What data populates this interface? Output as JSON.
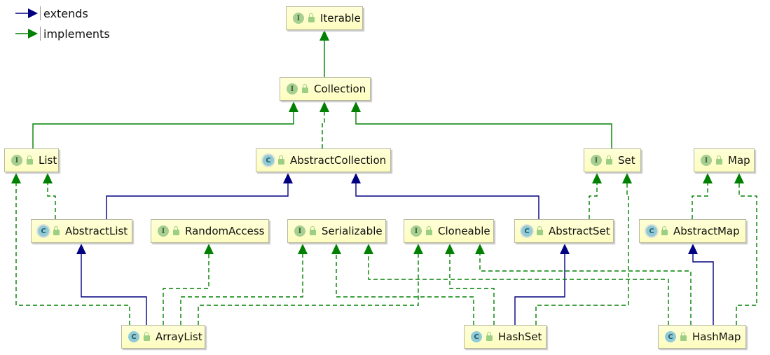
{
  "legend": [
    {
      "label": "extends",
      "color": "#000080"
    },
    {
      "label": "implements",
      "color": "#008000"
    }
  ],
  "colors": {
    "extends": "#000080",
    "implements": "#008000",
    "node_fill": "#ffffcc"
  },
  "nodes": [
    {
      "id": "Iterable",
      "label": "Iterable",
      "kind": "interface",
      "badge": "I"
    },
    {
      "id": "Collection",
      "label": "Collection",
      "kind": "interface",
      "badge": "I"
    },
    {
      "id": "List",
      "label": "List",
      "kind": "interface",
      "badge": "I"
    },
    {
      "id": "AbstractCollection",
      "label": "AbstractCollection",
      "kind": "abstract",
      "badge": "C"
    },
    {
      "id": "Set",
      "label": "Set",
      "kind": "interface",
      "badge": "I"
    },
    {
      "id": "Map",
      "label": "Map",
      "kind": "interface",
      "badge": "I"
    },
    {
      "id": "AbstractList",
      "label": "AbstractList",
      "kind": "abstract",
      "badge": "C"
    },
    {
      "id": "RandomAccess",
      "label": "RandomAccess",
      "kind": "interface",
      "badge": "I"
    },
    {
      "id": "Serializable",
      "label": "Serializable",
      "kind": "interface",
      "badge": "I"
    },
    {
      "id": "Cloneable",
      "label": "Cloneable",
      "kind": "interface",
      "badge": "I"
    },
    {
      "id": "AbstractSet",
      "label": "AbstractSet",
      "kind": "abstract",
      "badge": "C"
    },
    {
      "id": "AbstractMap",
      "label": "AbstractMap",
      "kind": "abstract",
      "badge": "C"
    },
    {
      "id": "ArrayList",
      "label": "ArrayList",
      "kind": "class",
      "badge": "C"
    },
    {
      "id": "HashSet",
      "label": "HashSet",
      "kind": "class",
      "badge": "C"
    },
    {
      "id": "HashMap",
      "label": "HashMap",
      "kind": "class",
      "badge": "C"
    }
  ],
  "edges": [
    {
      "from": "Collection",
      "to": "Iterable",
      "type": "extends-interface"
    },
    {
      "from": "List",
      "to": "Collection",
      "type": "extends-interface"
    },
    {
      "from": "AbstractCollection",
      "to": "Collection",
      "type": "implements"
    },
    {
      "from": "Set",
      "to": "Collection",
      "type": "extends-interface"
    },
    {
      "from": "AbstractList",
      "to": "AbstractCollection",
      "type": "extends"
    },
    {
      "from": "AbstractSet",
      "to": "AbstractCollection",
      "type": "extends"
    },
    {
      "from": "AbstractList",
      "to": "List",
      "type": "implements"
    },
    {
      "from": "AbstractSet",
      "to": "Set",
      "type": "implements"
    },
    {
      "from": "AbstractMap",
      "to": "Map",
      "type": "implements"
    },
    {
      "from": "ArrayList",
      "to": "List",
      "type": "implements"
    },
    {
      "from": "ArrayList",
      "to": "AbstractList",
      "type": "extends"
    },
    {
      "from": "ArrayList",
      "to": "RandomAccess",
      "type": "implements"
    },
    {
      "from": "ArrayList",
      "to": "Serializable",
      "type": "implements"
    },
    {
      "from": "ArrayList",
      "to": "Cloneable",
      "type": "implements"
    },
    {
      "from": "HashSet",
      "to": "Serializable",
      "type": "implements"
    },
    {
      "from": "HashSet",
      "to": "Cloneable",
      "type": "implements"
    },
    {
      "from": "HashSet",
      "to": "AbstractSet",
      "type": "extends"
    },
    {
      "from": "HashSet",
      "to": "Set",
      "type": "implements"
    },
    {
      "from": "HashMap",
      "to": "Serializable",
      "type": "implements"
    },
    {
      "from": "HashMap",
      "to": "Cloneable",
      "type": "implements"
    },
    {
      "from": "HashMap",
      "to": "AbstractMap",
      "type": "extends"
    },
    {
      "from": "HashMap",
      "to": "Map",
      "type": "implements"
    }
  ]
}
